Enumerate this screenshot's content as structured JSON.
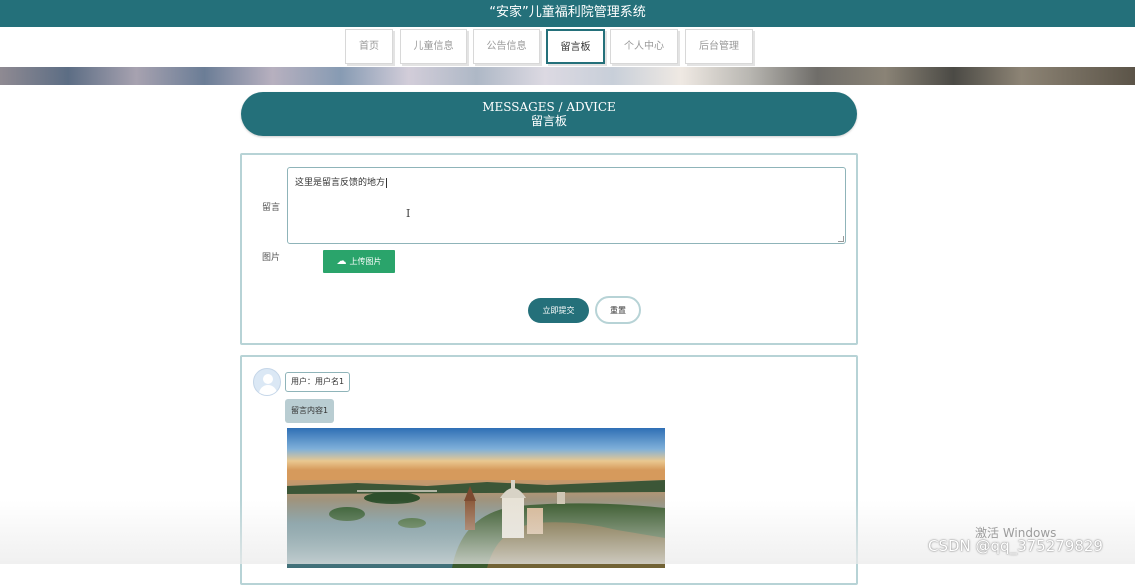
{
  "header": {
    "title": "“安家”儿童福利院管理系统"
  },
  "nav": {
    "items": [
      {
        "label": "首页",
        "active": false
      },
      {
        "label": "儿童信息",
        "active": false
      },
      {
        "label": "公告信息",
        "active": false
      },
      {
        "label": "留言板",
        "active": true
      },
      {
        "label": "个人中心",
        "active": false
      },
      {
        "label": "后台管理",
        "active": false
      }
    ]
  },
  "page_title": {
    "en": "MESSAGES / ADVICE",
    "zh": "留言板"
  },
  "form": {
    "message_label": "留言",
    "message_value": "这里是留言反馈的地方",
    "image_label": "图片",
    "upload_label": "上传图片",
    "upload_icon": "cloud-upload-icon",
    "submit_label": "立即提交",
    "reset_label": "重置"
  },
  "messages": [
    {
      "user": "用户：用户名1",
      "content": "留言内容1",
      "avatar_icon": "user-avatar-icon"
    }
  ],
  "os_overlay": {
    "activate_text": "激活 Windows",
    "watermark": "CSDN @qq_375279829"
  },
  "colors": {
    "primary": "#24707a",
    "upload": "#2aa46b",
    "border": "#b7d3d6"
  }
}
